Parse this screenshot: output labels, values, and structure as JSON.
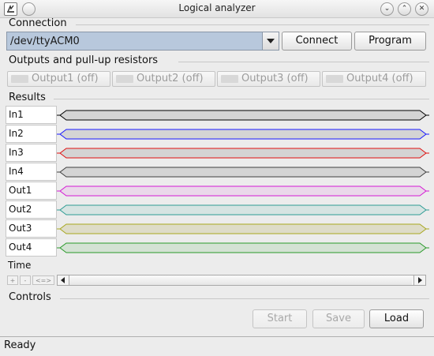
{
  "window": {
    "title": "Logical analyzer",
    "controls": {
      "minimize": "⌄",
      "maximize": "⌃",
      "close": "✕"
    }
  },
  "connection": {
    "group_label": "Connection",
    "port": "/dev/ttyACM0",
    "connect_label": "Connect",
    "program_label": "Program"
  },
  "outputs": {
    "group_label": "Outputs and pull-up resistors",
    "items": [
      {
        "label": "Output1 (off)"
      },
      {
        "label": "Output2 (off)"
      },
      {
        "label": "Output3 (off)"
      },
      {
        "label": "Output4 (off)"
      }
    ]
  },
  "results": {
    "group_label": "Results",
    "signals": [
      {
        "label": "In1",
        "color": "#000000",
        "fill": "#d4d4d4"
      },
      {
        "label": "In2",
        "color": "#1a1aff",
        "fill": "#d4d4d4"
      },
      {
        "label": "In3",
        "color": "#e01010",
        "fill": "#d4d4d4"
      },
      {
        "label": "In4",
        "color": "#404040",
        "fill": "#d4d4d4"
      },
      {
        "label": "Out1",
        "color": "#d41ad4",
        "fill": "#ead8ea"
      },
      {
        "label": "Out2",
        "color": "#2e9c94",
        "fill": "#d6e4e2"
      },
      {
        "label": "Out3",
        "color": "#a8a820",
        "fill": "#dedcc8"
      },
      {
        "label": "Out4",
        "color": "#2a9a2a",
        "fill": "#d4e2d4"
      }
    ],
    "time_label": "Time",
    "zoom_in": "+",
    "zoom_out": "-",
    "zoom_fit": "<=>"
  },
  "controls": {
    "group_label": "Controls",
    "start_label": "Start",
    "save_label": "Save",
    "load_label": "Load"
  },
  "status": "Ready"
}
